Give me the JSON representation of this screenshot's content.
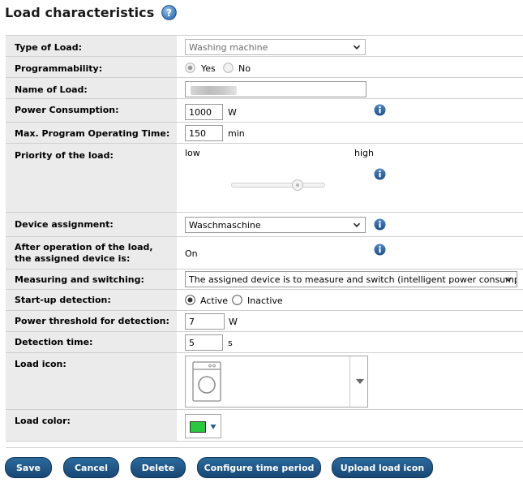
{
  "header": {
    "title": "Load characteristics",
    "help_icon": "question-mark-icon"
  },
  "colors": {
    "accent": "#1c5d98",
    "button_bg": "#1e5584",
    "label_bg": "#ebebeb",
    "load_color": "#27c93f"
  },
  "rows": {
    "type_of_load": {
      "label": "Type of Load:",
      "value": "Washing machine"
    },
    "programmability": {
      "label": "Programmability:",
      "yes": "Yes",
      "no": "No",
      "selected": "Yes"
    },
    "name_of_load": {
      "label": "Name of Load:"
    },
    "power_consumption": {
      "label": "Power Consumption:",
      "value": "1000",
      "unit": "W"
    },
    "max_operating_time": {
      "label": "Max. Program Operating Time:",
      "value": "150",
      "unit": "min"
    },
    "priority": {
      "label": "Priority of the load:",
      "low": "low",
      "high": "high",
      "slider_level": 0.7
    },
    "device_assignment": {
      "label": "Device assignment:",
      "value": "Waschmaschine"
    },
    "after_operation": {
      "label": "After operation of the load, the assigned device is:",
      "value": "On"
    },
    "measuring_switching": {
      "label": "Measuring and switching:",
      "value": "The assigned device is to measure and switch (intelligent power consumption)"
    },
    "startup_detection": {
      "label": "Start-up detection:",
      "active": "Active",
      "inactive": "Inactive",
      "selected": "Active"
    },
    "power_threshold": {
      "label": "Power threshold for detection:",
      "value": "7",
      "unit": "W"
    },
    "detection_time": {
      "label": "Detection time:",
      "value": "5",
      "unit": "s"
    },
    "load_icon": {
      "label": "Load icon:",
      "icon": "washing-machine-icon"
    },
    "load_color": {
      "label": "Load color:"
    }
  },
  "buttons": {
    "save": "Save",
    "cancel": "Cancel",
    "delete": "Delete",
    "configure": "Configure time period",
    "upload": "Upload load icon"
  }
}
